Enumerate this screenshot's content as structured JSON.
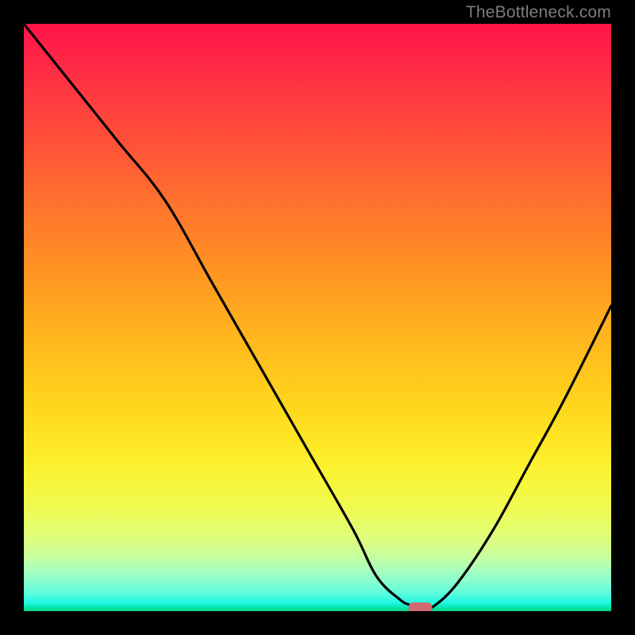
{
  "watermark": "TheBottleneck.com",
  "chart_data": {
    "type": "line",
    "title": "",
    "xlabel": "",
    "ylabel": "",
    "xlim": [
      0,
      100
    ],
    "ylim": [
      0,
      100
    ],
    "grid": false,
    "background": "red-yellow-green vertical gradient",
    "series": [
      {
        "name": "curve",
        "color": "#000000",
        "x": [
          0,
          8,
          16,
          24,
          32,
          40,
          48,
          56,
          60,
          64,
          66,
          68,
          70,
          74,
          80,
          86,
          92,
          100
        ],
        "y": [
          100,
          90,
          80,
          70,
          56,
          42,
          28,
          14,
          6,
          2,
          1,
          0.5,
          1,
          5,
          14,
          25,
          36,
          52
        ]
      }
    ],
    "marker": {
      "shape": "rounded-rect",
      "color": "#d06a70",
      "x": 67.5,
      "y": 0.5,
      "width": 4,
      "height": 2
    }
  }
}
